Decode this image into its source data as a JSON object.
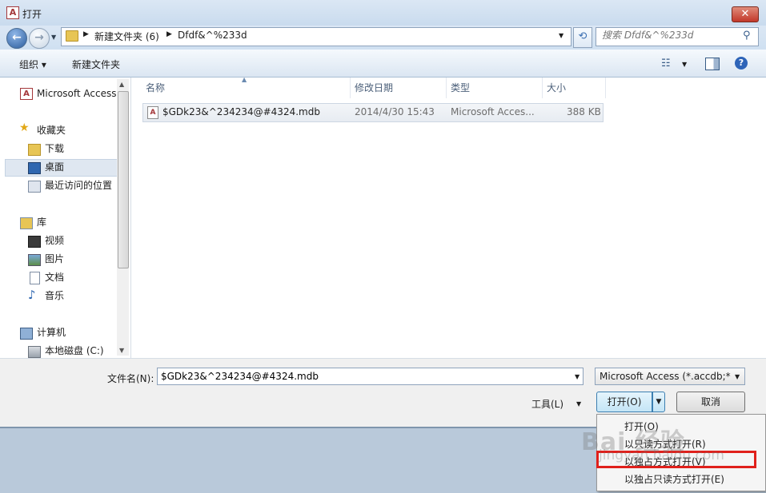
{
  "window": {
    "title": "打开",
    "close_label": "✕"
  },
  "address": {
    "part1": "新建文件夹 (6)",
    "part2": "Dfdf&^%233d"
  },
  "search": {
    "placeholder": "搜索 Dfdf&^%233d"
  },
  "toolbar": {
    "organize_label": "组织 ▾",
    "newfolder_label": "新建文件夹"
  },
  "nav": {
    "items": [
      {
        "label": "Microsoft Access",
        "icon": "access-icon"
      },
      {
        "label": "收藏夹",
        "icon": "star-icon"
      },
      {
        "label": "下载",
        "icon": "download-folder-icon"
      },
      {
        "label": "桌面",
        "icon": "desktop-icon"
      },
      {
        "label": "最近访问的位置",
        "icon": "recent-places-icon"
      },
      {
        "label": "库",
        "icon": "library-icon"
      },
      {
        "label": "视频",
        "icon": "video-icon"
      },
      {
        "label": "图片",
        "icon": "picture-icon"
      },
      {
        "label": "文档",
        "icon": "document-icon"
      },
      {
        "label": "音乐",
        "icon": "music-icon"
      },
      {
        "label": "计算机",
        "icon": "computer-icon"
      },
      {
        "label": "本地磁盘 (C:)",
        "icon": "drive-icon"
      }
    ]
  },
  "columns": {
    "name": "名称",
    "date": "修改日期",
    "type": "类型",
    "size": "大小"
  },
  "file": {
    "name": "$GDk23&^234234@#4324.mdb",
    "date": "2014/4/30 15:43",
    "type": "Microsoft Acces...",
    "size": "388 KB"
  },
  "bottom": {
    "filename_label": "文件名(N):",
    "filename_value": "$GDk23&^234234@#4324.mdb",
    "filter_value": "Microsoft Access (*.accdb;*.m",
    "tools_label": "工具(L)",
    "open_label": "打开(O)",
    "cancel_label": "取消"
  },
  "open_menu": {
    "items": [
      "打开(O)",
      "以只读方式打开(R)",
      "以独占方式打开(V)",
      "以独占只读方式打开(E)"
    ]
  },
  "watermark": {
    "text": "Bai 经验",
    "sub": "jingyan.baidu.com"
  },
  "colors": {
    "highlight_border": "#e0201b",
    "accent": "#3c7fb1"
  }
}
